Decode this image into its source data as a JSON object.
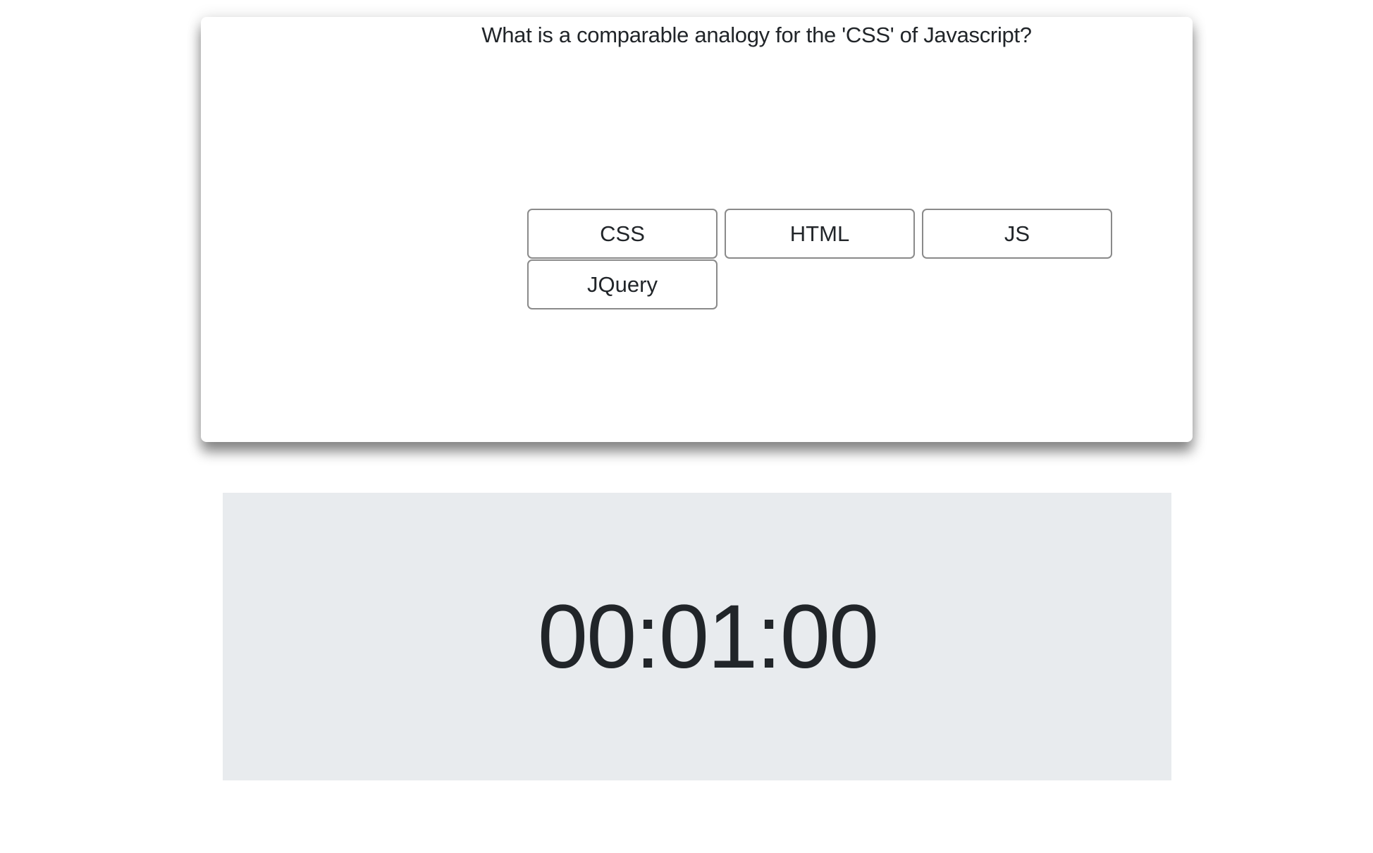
{
  "quiz": {
    "question": "What is a comparable analogy for the 'CSS' of Javascript?",
    "options": [
      "CSS",
      "HTML",
      "JS",
      "JQuery"
    ]
  },
  "timer": {
    "display": "00:01:00"
  },
  "colors": {
    "timer_background": "#e8ebee",
    "button_border": "#8a8a8a",
    "text": "#212529"
  }
}
